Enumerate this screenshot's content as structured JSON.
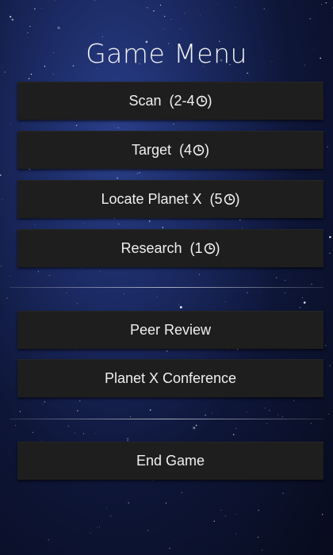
{
  "title": "Game Menu",
  "buttons": {
    "scan": {
      "label": "Scan",
      "cost": "2-4"
    },
    "target": {
      "label": "Target",
      "cost": "4"
    },
    "locate": {
      "label": "Locate Planet X",
      "cost": "5"
    },
    "research": {
      "label": "Research",
      "cost": "1"
    },
    "peer_review": {
      "label": "Peer Review"
    },
    "conference": {
      "label": "Planet X Conference"
    },
    "end_game": {
      "label": "End Game"
    }
  },
  "icons": {
    "cost_icon": "clock-icon"
  },
  "colors": {
    "button_bg": "#1e1e1e",
    "text": "#f0f0f0"
  }
}
